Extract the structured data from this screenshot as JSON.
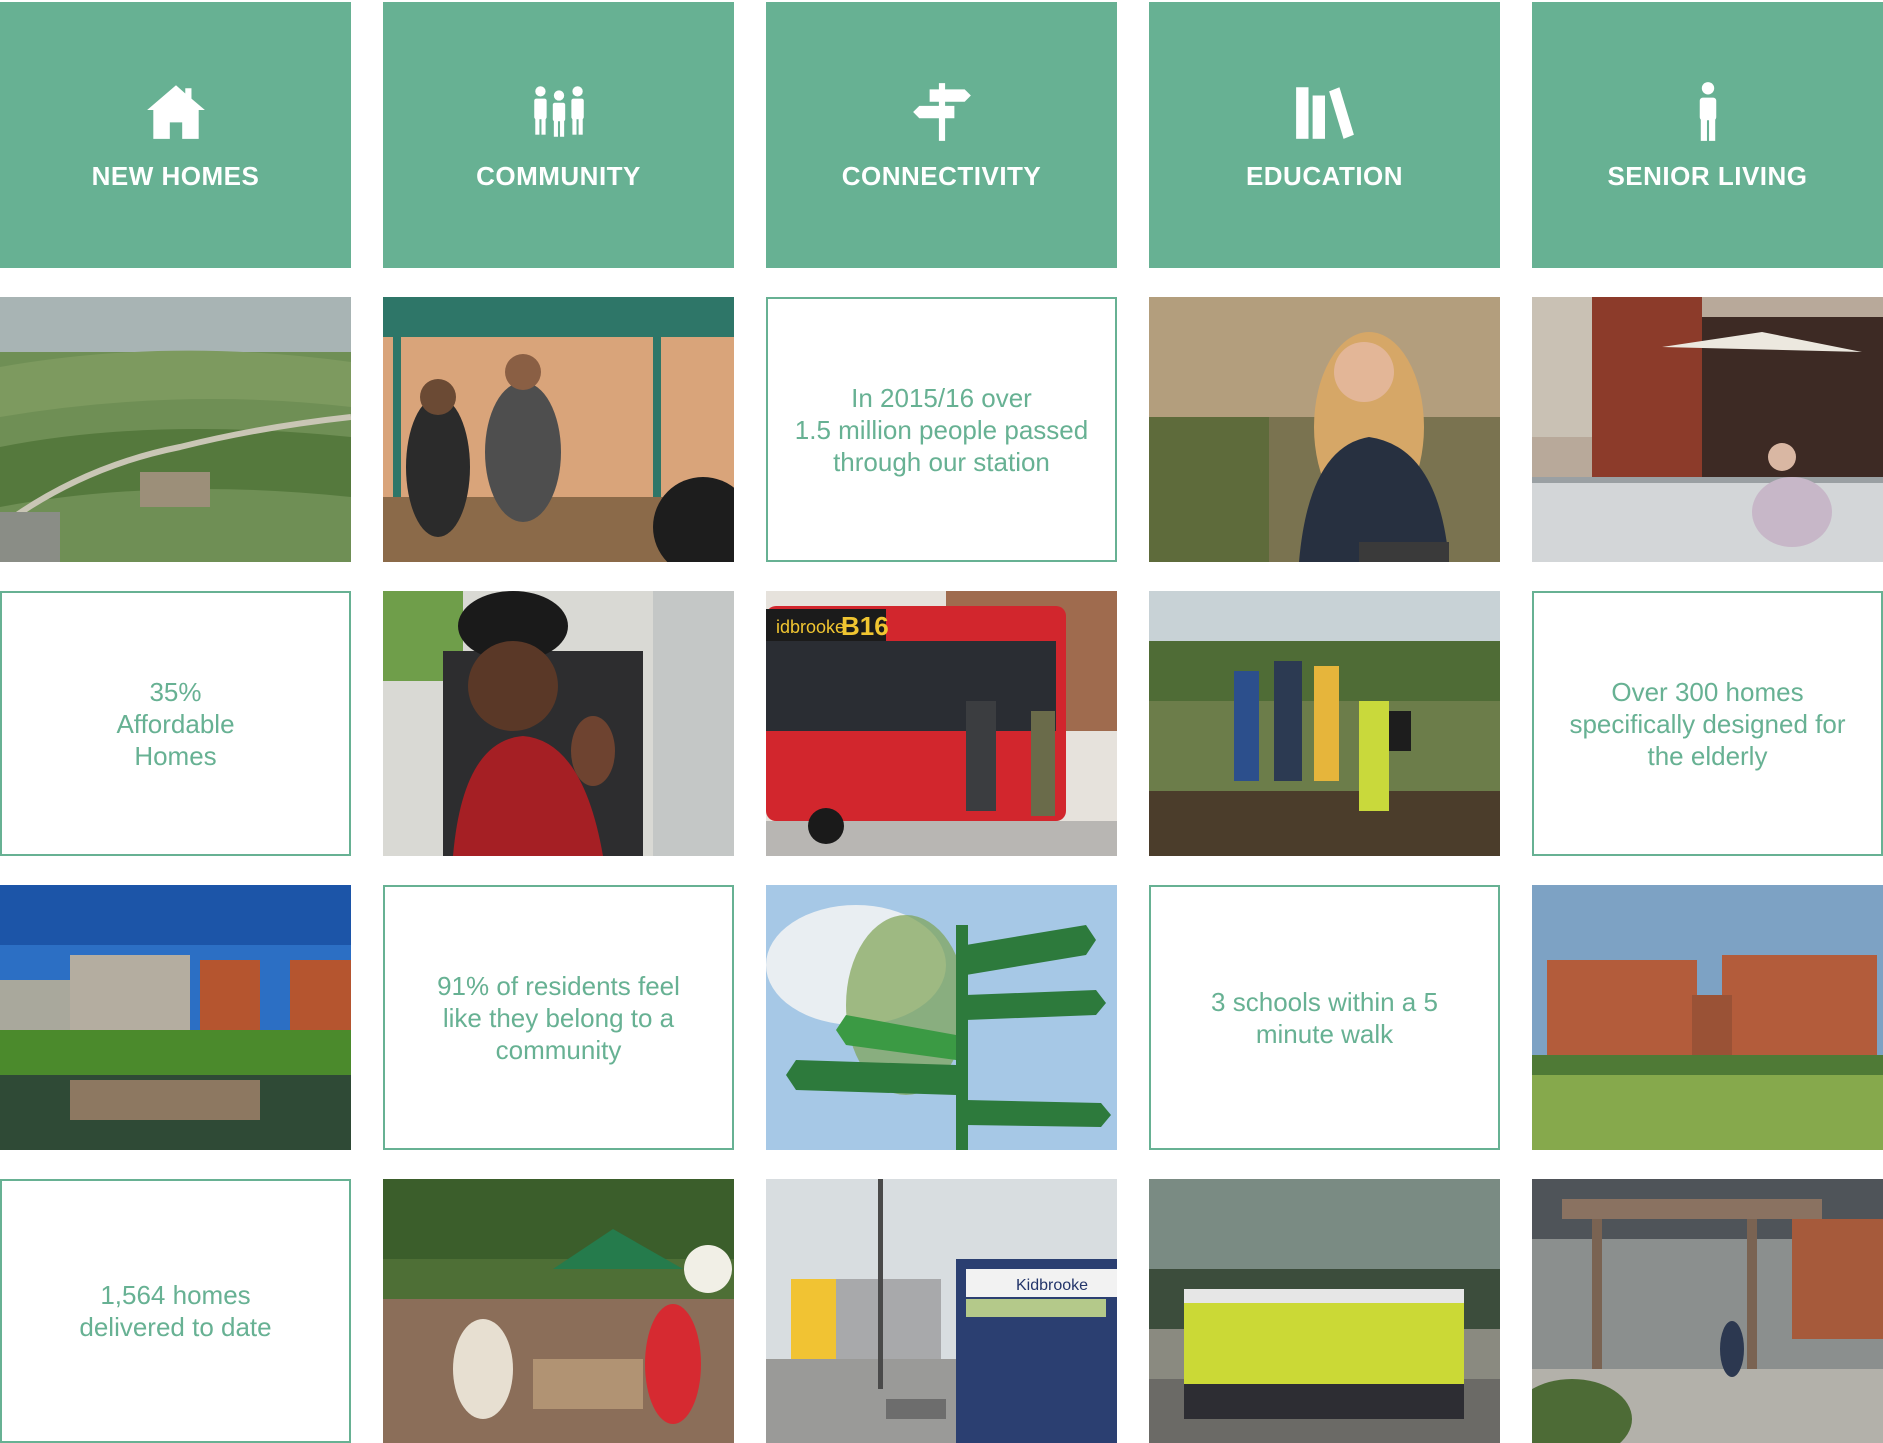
{
  "colors": {
    "brand_green": "#67b193",
    "background": "#ffffff"
  },
  "headers": [
    {
      "label": "NEW HOMES",
      "icon": "house-icon"
    },
    {
      "label": "COMMUNITY",
      "icon": "people-icon"
    },
    {
      "label": "CONNECTIVITY",
      "icon": "signpost-icon"
    },
    {
      "label": "EDUCATION",
      "icon": "books-icon"
    },
    {
      "label": "SENIOR LIVING",
      "icon": "person-icon"
    }
  ],
  "stats": {
    "station": "In 2015/16 over\n1.5 million people passed\nthrough our station",
    "affordable": "35%\nAffordable\nHomes",
    "elderly": "Over 300 homes\nspecifically designed for\nthe elderly",
    "belong": "91% of residents feel\nlike they belong to a\ncommunity",
    "schools": "3 schools within a 5\nminute walk",
    "homes": "1,564 homes\ndelivered to date"
  },
  "photo_text": {
    "bus_route": "B16",
    "bus_dest": "idbrooke",
    "station_sign": "Kidbrooke"
  }
}
